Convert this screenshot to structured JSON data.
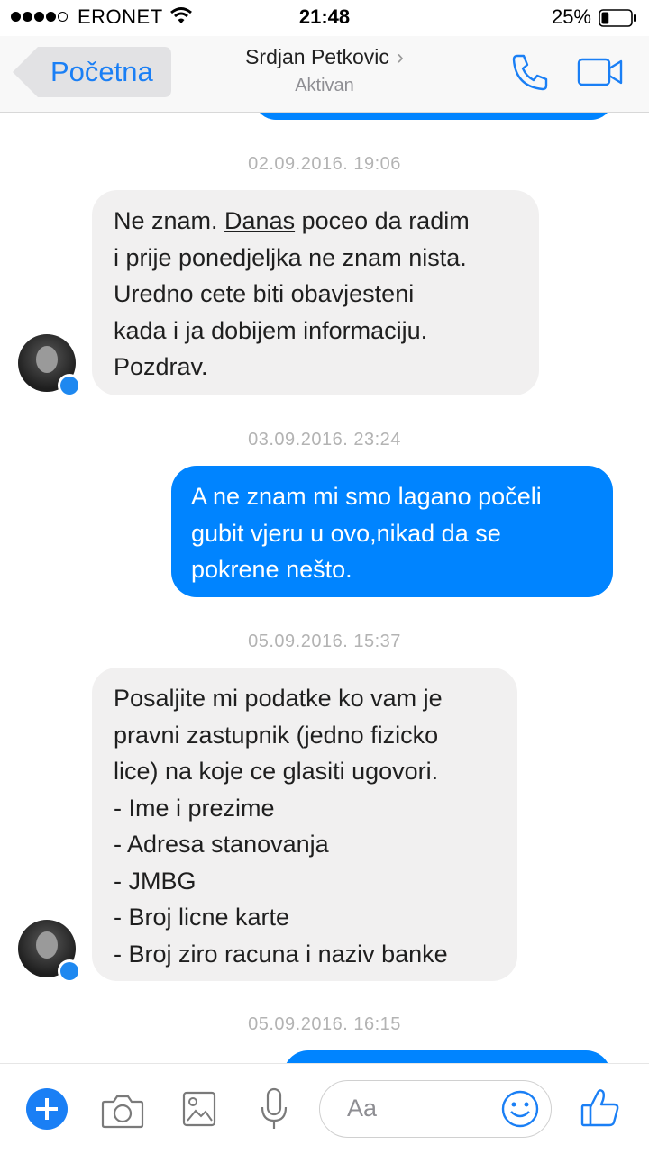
{
  "status_bar": {
    "carrier": "ERONET",
    "time": "21:48",
    "battery_percent": "25%",
    "signal_bars": 4,
    "signal_max": 5,
    "battery_level": 0.25
  },
  "header": {
    "back_label": "Početna",
    "contact_name": "Srdjan Petkovic",
    "contact_status": "Aktivan",
    "icons": [
      "phone-icon",
      "video-camera-icon"
    ]
  },
  "messages": [
    {
      "timestamp": "02.09.2016. 19:06"
    },
    {
      "direction": "incoming",
      "lines": [
        "Ne znam. ",
        "Danas",
        " poceo da radim",
        "i prije ponedjeljka ne znam nista.",
        "Uredno cete biti obavjesteni",
        "kada i ja dobijem informaciju.",
        "Pozdrav."
      ]
    },
    {
      "timestamp": "03.09.2016. 23:24"
    },
    {
      "direction": "outgoing",
      "lines": [
        "A ne znam mi smo lagano počeli",
        "gubit vjeru u ovo,nikad da se",
        "pokrene nešto."
      ]
    },
    {
      "timestamp": "05.09.2016. 15:37"
    },
    {
      "direction": "incoming",
      "lines": [
        "Posaljite mi podatke ko vam je",
        "pravni zastupnik (jedno fizicko",
        "lice) na koje ce glasiti ugovori.",
        "- Ime i prezime",
        "- Adresa stanovanja",
        "- JMBG",
        "- Broj licne karte",
        "- Broj ziro racuna i naziv banke"
      ]
    },
    {
      "timestamp": "05.09.2016. 16:15"
    }
  ],
  "composer": {
    "placeholder": "Aa",
    "icons": [
      "plus-icon",
      "camera-icon",
      "image-icon",
      "microphone-icon",
      "emoji-icon",
      "thumbs-up-icon"
    ]
  },
  "colors": {
    "accent": "#1a7ff5",
    "outgoing_bubble": "#0084ff",
    "incoming_bubble": "#f1f0f0",
    "timestamp": "#b3b3b3"
  }
}
